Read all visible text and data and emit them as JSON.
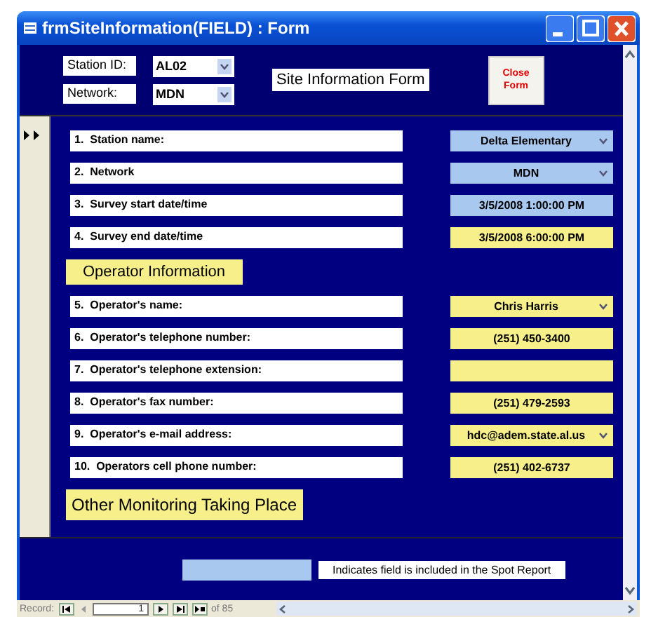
{
  "window": {
    "title": "frmSiteInformation(FIELD) : Form"
  },
  "header": {
    "station_id": {
      "label": "Station ID:",
      "value": "AL02"
    },
    "network": {
      "label": "Network:",
      "value": "MDN"
    },
    "form_title": "Site Information Form",
    "close_button": "Close Form"
  },
  "items": [
    {
      "kind": "field",
      "label": "1.  Station name:",
      "value": "Delta Elementary",
      "dropdown": true,
      "spot_report": true
    },
    {
      "kind": "field",
      "label": "2.  Network",
      "value": "MDN",
      "dropdown": true,
      "spot_report": true
    },
    {
      "kind": "field",
      "label": "3.  Survey start date/time",
      "value": "3/5/2008 1:00:00 PM",
      "dropdown": false,
      "spot_report": true
    },
    {
      "kind": "field",
      "label": "4.  Survey end date/time",
      "value": "3/5/2008 6:00:00 PM",
      "dropdown": false,
      "spot_report": false
    },
    {
      "kind": "heading",
      "label": "Operator Information"
    },
    {
      "kind": "field",
      "label": "5.  Operator's name:",
      "value": "Chris Harris",
      "dropdown": true,
      "spot_report": false
    },
    {
      "kind": "field",
      "label": "6.  Operator's telephone number:",
      "value": "(251) 450-3400",
      "dropdown": false,
      "spot_report": false
    },
    {
      "kind": "field",
      "label": "7.  Operator's telephone extension:",
      "dropdown": false,
      "spot_report": false
    },
    {
      "kind": "field",
      "label": "8.  Operator's fax number:",
      "value": "(251) 479-2593",
      "dropdown": false,
      "spot_report": false
    },
    {
      "kind": "field",
      "label": "9.  Operator's e-mail address:",
      "value": "hdc@adem.state.al.us",
      "dropdown": true,
      "spot_report": false
    },
    {
      "kind": "field",
      "label": "10.  Operators cell phone number:",
      "value": "(251) 402-6737",
      "dropdown": false,
      "spot_report": false
    },
    {
      "kind": "heading",
      "label": "Other Monitoring Taking Place",
      "large": true
    }
  ],
  "legend": {
    "text": "Indicates field is included in the Spot Report"
  },
  "navigation": {
    "label": "Record:",
    "current": "1",
    "total": "of 85"
  }
}
